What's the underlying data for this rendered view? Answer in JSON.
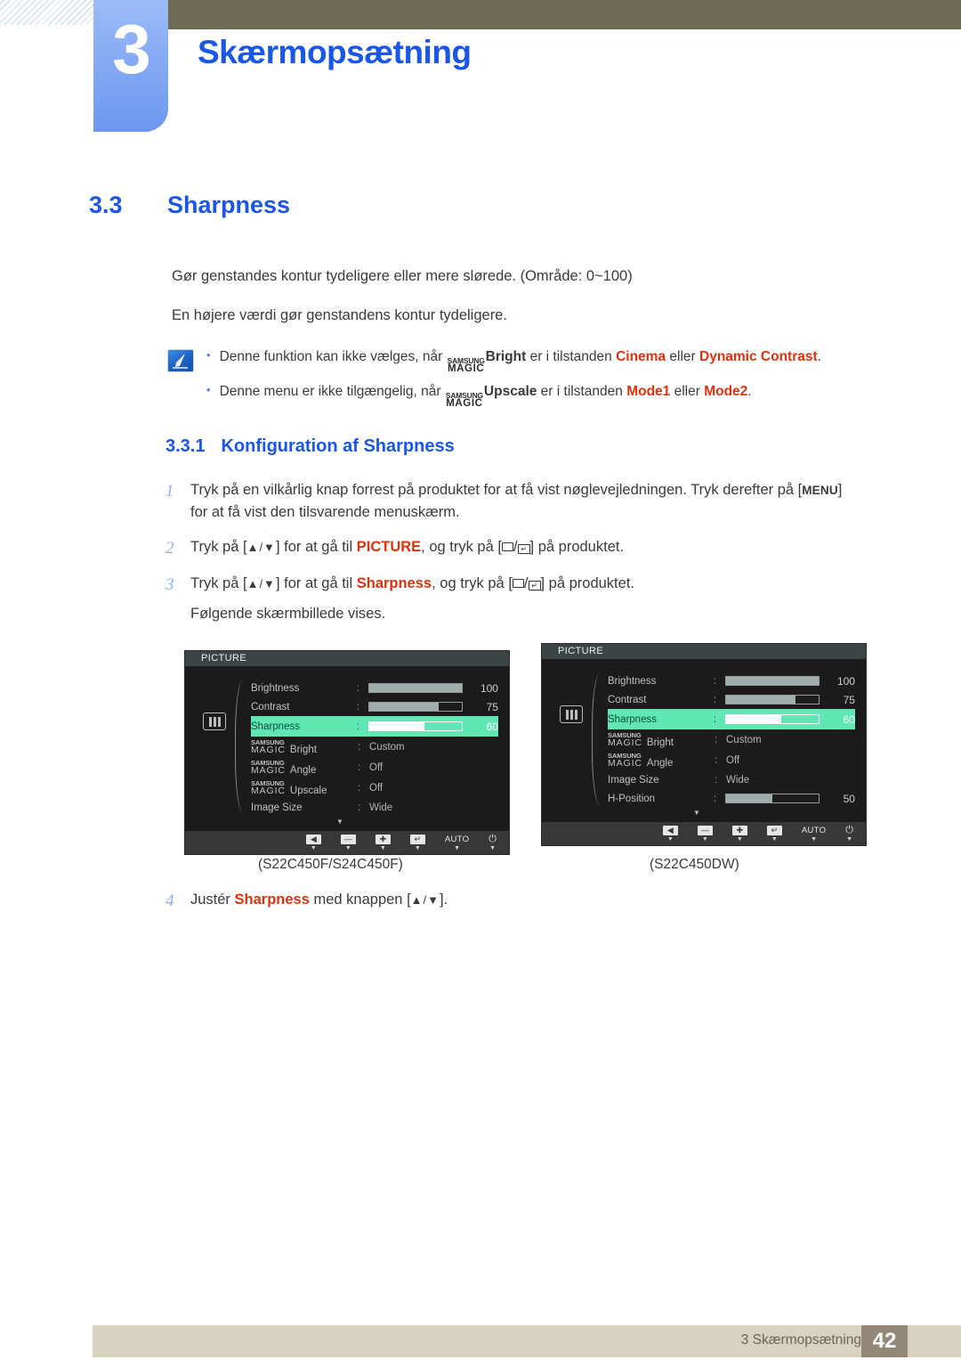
{
  "header": {
    "chapter_number": "3",
    "chapter_title": "Skærmopsætning"
  },
  "section": {
    "number": "3.3",
    "title": "Sharpness",
    "intro_1": "Gør genstandes kontur tydeligere eller mere slørede. (Område: 0~100)",
    "intro_2": "En højere værdi gør genstandens kontur tydeligere."
  },
  "note": {
    "icon": "note-pen-icon",
    "items": [
      {
        "pre": "Denne funktion kan ikke vælges, når ",
        "magic_small": "SAMSUNG",
        "magic_big": "MAGIC",
        "feature": "Bright",
        "mid": " er i tilstanden ",
        "value1": "Cinema",
        "conj": " eller ",
        "value2": "Dynamic Contrast",
        "post": "."
      },
      {
        "pre": "Denne menu er ikke tilgængelig, når ",
        "magic_small": "SAMSUNG",
        "magic_big": "MAGIC",
        "feature": "Upscale",
        "mid": " er i tilstanden ",
        "value1": "Mode1",
        "conj": " eller ",
        "value2": "Mode2",
        "post": "."
      }
    ]
  },
  "subsection": {
    "number": "3.3.1",
    "title": "Konfiguration af Sharpness"
  },
  "steps": [
    {
      "num": "1",
      "text_a": "Tryk på en vilkårlig knap forrest på produktet for at få vist nøglevejledningen. Tryk derefter på [",
      "key": "MENU",
      "text_b": "]",
      "text_c": "for at få vist den tilsvarende menuskærm."
    },
    {
      "num": "2",
      "text_a": "Tryk på [",
      "arrows": "▲/▼",
      "text_b": "] for at gå til ",
      "highlight": "PICTURE",
      "text_c": ", og tryk på [",
      "text_d": "] på produktet."
    },
    {
      "num": "3",
      "text_a": "Tryk på [",
      "arrows": "▲/▼",
      "text_b": "] for at gå til ",
      "highlight": "Sharpness",
      "text_c": ", og tryk på [",
      "text_d": "] på produktet.",
      "substep": "Følgende skærmbillede vises."
    },
    {
      "num": "4",
      "text_a": "Justér ",
      "highlight": "Sharpness",
      "text_b": " med knappen [",
      "arrows": "▲/▼",
      "text_c": "]."
    }
  ],
  "osd_left": {
    "title": "PICTURE",
    "caption": "(S22C450F/S24C450F)",
    "rows": [
      {
        "label": "Brightness",
        "type": "bar",
        "value": "100",
        "fill": 100
      },
      {
        "label": "Contrast",
        "type": "bar",
        "value": "75",
        "fill": 75
      },
      {
        "label": "Sharpness",
        "type": "bar",
        "value": "60",
        "fill": 60,
        "selected": true
      },
      {
        "label": "Bright",
        "type": "text",
        "value": "Custom",
        "magic": true,
        "magic_small": "SAMSUNG",
        "magic_big": "MAGIC"
      },
      {
        "label": "Angle",
        "type": "text",
        "value": "Off",
        "magic": true,
        "magic_small": "SAMSUNG",
        "magic_big": "MAGIC"
      },
      {
        "label": "Upscale",
        "type": "text",
        "value": "Off",
        "magic": true,
        "magic_small": "SAMSUNG",
        "magic_big": "MAGIC"
      },
      {
        "label": "Image Size",
        "type": "text",
        "value": "Wide"
      }
    ],
    "more_indicator": "▼",
    "buttons": [
      "back-icon",
      "minus-icon",
      "plus-icon",
      "enter-icon",
      "AUTO",
      "power-icon"
    ],
    "auto_label": "AUTO"
  },
  "osd_right": {
    "title": "PICTURE",
    "caption": "(S22C450DW)",
    "rows": [
      {
        "label": "Brightness",
        "type": "bar",
        "value": "100",
        "fill": 100
      },
      {
        "label": "Contrast",
        "type": "bar",
        "value": "75",
        "fill": 75
      },
      {
        "label": "Sharpness",
        "type": "bar",
        "value": "60",
        "fill": 60,
        "selected": true
      },
      {
        "label": "Bright",
        "type": "text",
        "value": "Custom",
        "magic": true,
        "magic_small": "SAMSUNG",
        "magic_big": "MAGIC"
      },
      {
        "label": "Angle",
        "type": "text",
        "value": "Off",
        "magic": true,
        "magic_small": "SAMSUNG",
        "magic_big": "MAGIC"
      },
      {
        "label": "Image Size",
        "type": "text",
        "value": "Wide"
      },
      {
        "label": "H-Position",
        "type": "bar",
        "value": "50",
        "fill": 50
      }
    ],
    "more_indicator": "▼",
    "buttons": [
      "back-icon",
      "minus-icon",
      "plus-icon",
      "enter-icon",
      "AUTO",
      "power-icon"
    ],
    "auto_label": "AUTO"
  },
  "footer": {
    "text": "3 Skærmopsætning",
    "page": "42"
  },
  "colors": {
    "accent_blue": "#1a56e8",
    "tab_blue": "#86aaf4",
    "olive": "#6e6b55",
    "red": "#e0310d",
    "osd_select_green": "#5fe8b4",
    "footer_bar": "#d8d2c0",
    "footer_page": "#938777"
  }
}
